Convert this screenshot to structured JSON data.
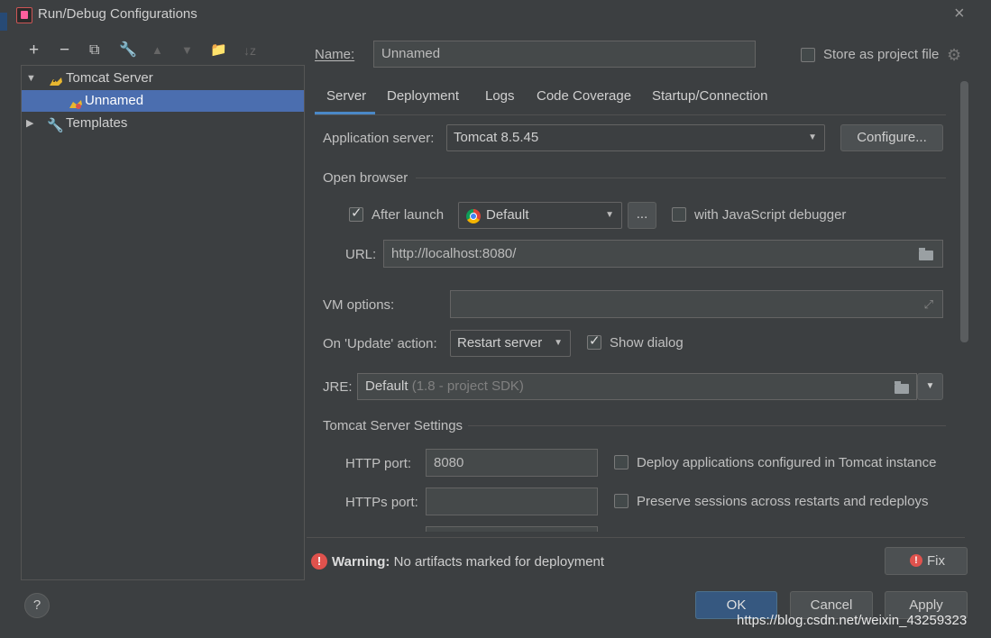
{
  "window": {
    "title": "Run/Debug Configurations"
  },
  "toolbar": [
    "+",
    "−",
    "⧉",
    "🔧",
    "▲",
    "▼",
    "📁",
    "↓z"
  ],
  "tree": {
    "group": "Tomcat Server",
    "child": "Unnamed",
    "templates": "Templates"
  },
  "name": {
    "label": "Name:",
    "value": "Unnamed"
  },
  "store_as_project_file": "Store as project file",
  "tabs": [
    "Server",
    "Deployment",
    "Logs",
    "Code Coverage",
    "Startup/Connection"
  ],
  "server": {
    "app_server_label": "Application server:",
    "app_server_value": "Tomcat 8.5.45",
    "configure_label": "Configure...",
    "open_browser_label": "Open browser",
    "after_launch_label": "After launch",
    "browser_value": "Default",
    "ellipsis": "...",
    "js_debugger_label": "with JavaScript debugger",
    "url_label": "URL:",
    "url_value": "http://localhost:8080/",
    "vm_options_label": "VM options:",
    "on_update_label": "On 'Update' action:",
    "on_update_value": "Restart server",
    "show_dialog_label": "Show dialog",
    "jre_label": "JRE:",
    "jre_value": "Default",
    "jre_hint": "(1.8 - project SDK)",
    "tomcat_settings_label": "Tomcat Server Settings",
    "http_port_label": "HTTP port:",
    "http_port_value": "8080",
    "https_port_label": "HTTPs port:",
    "https_port_value": "",
    "deploy_apps_label": "Deploy applications configured in Tomcat instance",
    "preserve_sessions_label": "Preserve sessions across restarts and redeploys"
  },
  "warning": {
    "bold": "Warning:",
    "text": "No artifacts marked for deployment",
    "icon": "!"
  },
  "buttons": {
    "fix": "Fix",
    "ok": "OK",
    "cancel": "Cancel",
    "apply": "Apply",
    "help": "?"
  },
  "watermark": "https://blog.csdn.net/weixin_43259323"
}
